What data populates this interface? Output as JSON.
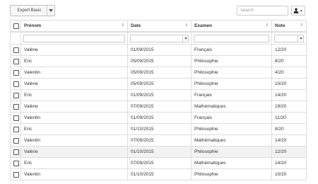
{
  "toolbar": {
    "export_label": "Export Basic",
    "search_placeholder": "Search"
  },
  "table": {
    "headers": [
      "Prénom",
      "Date",
      "Examen",
      "Note"
    ],
    "rows": [
      [
        "Valène",
        "01/09/2015",
        "Français",
        "12/20"
      ],
      [
        "Eric",
        "05/09/2015",
        "Philosophie",
        "8/20"
      ],
      [
        "Valentin",
        "05/09/2015",
        "Philosophie",
        "4/20"
      ],
      [
        "Valène",
        "05/09/2015",
        "Philosophie",
        "10/20"
      ],
      [
        "Eric",
        "01/09/2015",
        "Français",
        "14/20"
      ],
      [
        "Valène",
        "07/09/2015",
        "Mathématiques",
        "19/20"
      ],
      [
        "Valentin",
        "01/09/2015",
        "Français",
        "11/20"
      ],
      [
        "Eric",
        "01/10/2015",
        "Philosophie",
        "8/20"
      ],
      [
        "Valentin",
        "07/09/2015",
        "Mathématiques",
        "14/20"
      ],
      [
        "Valène",
        "01/10/2015",
        "Philosophie",
        "12/20"
      ],
      [
        "Eric",
        "07/09/2015",
        "Mathématiques",
        "14/20"
      ],
      [
        "Valentin",
        "01/10/2015",
        "Philosophie",
        "10/20"
      ]
    ],
    "highlighted_row": 9
  },
  "icons": {
    "export_caret": "chevron-down-icon",
    "columns_toggle": "user-columns-icon",
    "sort": "sort-icon",
    "filter_dropdown": "chevron-down-icon"
  }
}
